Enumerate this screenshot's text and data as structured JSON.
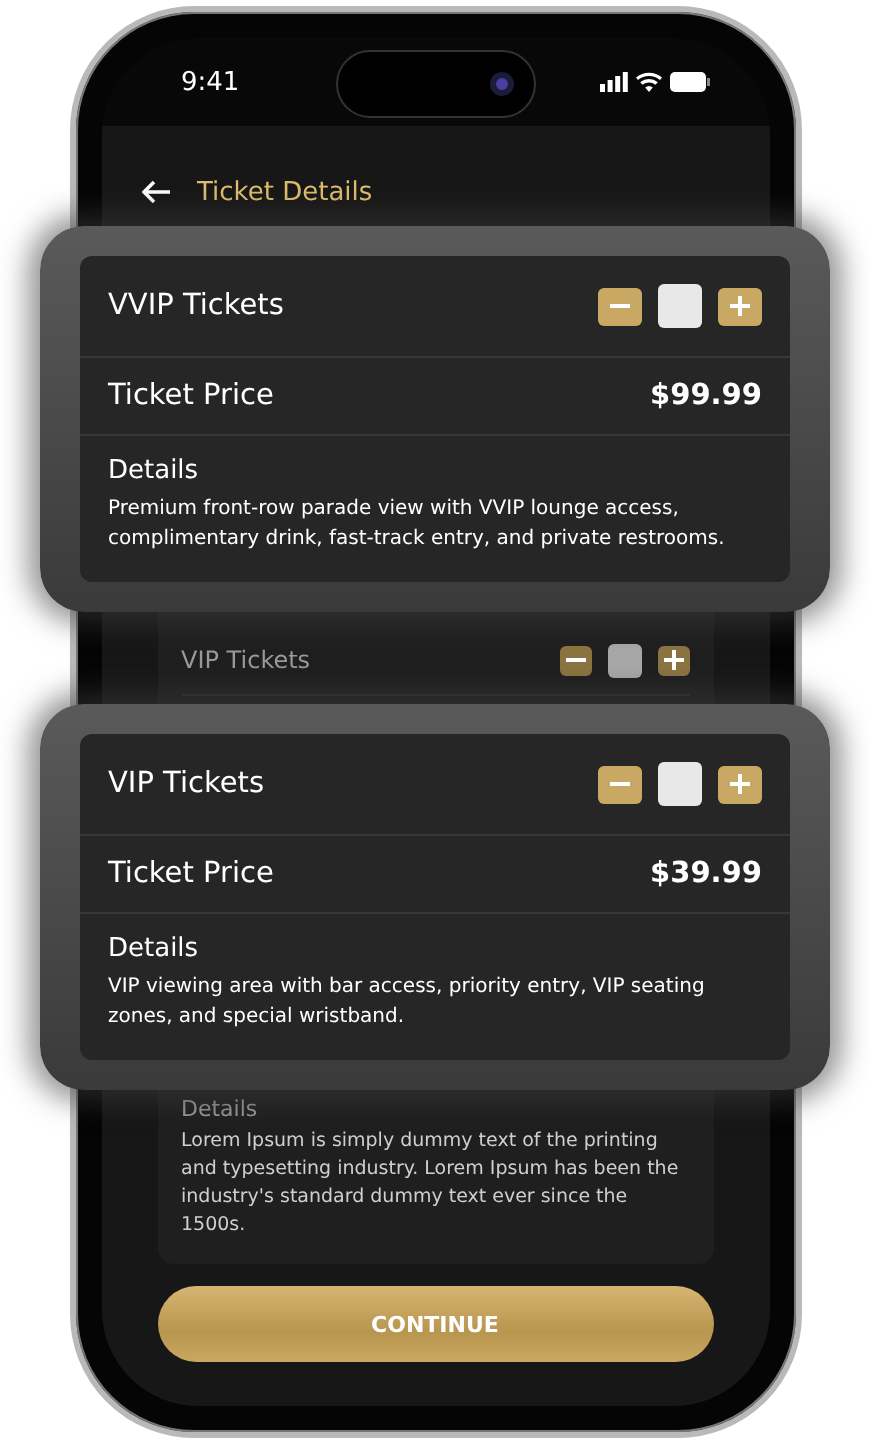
{
  "status_bar": {
    "time": "9:41"
  },
  "header": {
    "title": "Ticket Details"
  },
  "background_ticket": {
    "title": "VIP Tickets",
    "details_title": "Details",
    "details": "Lorem Ipsum is simply dummy text of the printing and typesetting industry. Lorem Ipsum has been the industry's standard dummy text ever since the 1500s."
  },
  "cards": [
    {
      "title": "VVIP Tickets",
      "price_label": "Ticket Price",
      "price": "$99.99",
      "details_title": "Details",
      "details": "Premium front-row parade view with VVIP lounge access, complimentary drink, fast-track entry, and private restrooms."
    },
    {
      "title": "VIP Tickets",
      "price_label": "Ticket Price",
      "price": "$39.99",
      "details_title": "Details",
      "details": "VIP viewing area with bar access, priority entry, VIP seating zones, and special wristband."
    }
  ],
  "button": "CONTINUE"
}
